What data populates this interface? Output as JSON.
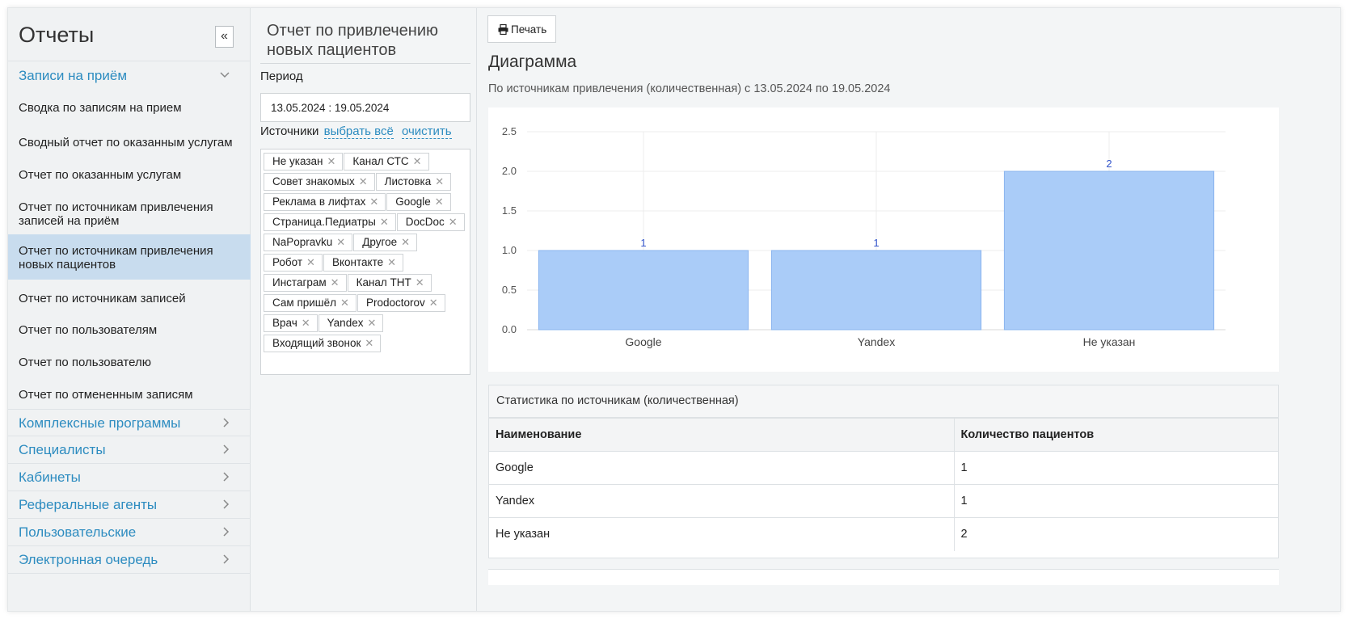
{
  "sidebar": {
    "title": "Отчеты",
    "collapse_label": "«",
    "open_group": "Записи на приём",
    "items": [
      "Сводка по записям на прием",
      "Сводный отчет по оказанным услугам",
      "Отчет по оказанным услугам",
      "Отчет по источникам привлечения записей на приём",
      "Отчет по источникам привлечения новых пациентов",
      "Отчет по источникам записей",
      "Отчет по пользователям",
      "Отчет по пользователю",
      "Отчет по отмененным записям"
    ],
    "active_index": 4,
    "groups": [
      "Комплексные программы",
      "Специалисты",
      "Кабинеты",
      "Реферальные агенты",
      "Пользовательские",
      "Электронная очередь"
    ]
  },
  "filter": {
    "title": "Отчет по привлечению новых пациентов",
    "period_label": "Период",
    "period_value": "13.05.2024  :  19.05.2024",
    "sources_label": "Источники",
    "select_all": "выбрать всё",
    "clear": "очистить",
    "tags": [
      "Не указан",
      "Канал СТС",
      "Совет знакомых",
      "Листовка",
      "Реклама в лифтах",
      "Google",
      "Страница.Педиатры",
      "DocDoc",
      "NaPopravku",
      "Другое",
      "Робот",
      "Вконтакте",
      "Инстаграм",
      "Канал ТНТ",
      "Сам пришёл",
      "Prodoctorov",
      "Врач",
      "Yandex",
      "Входящий звонок"
    ],
    "tag_remove": "✕"
  },
  "main": {
    "print_label": "Печать",
    "heading": "Диаграмма",
    "subtitle": "По источникам привлечения (количественная) с 13.05.2024 по 19.05.2024",
    "stats_title": "Статистика по источникам (количественная)",
    "table_headers": [
      "Наименование",
      "Количество пациентов"
    ],
    "table_rows": [
      [
        "Google",
        "1"
      ],
      [
        "Yandex",
        "1"
      ],
      [
        "Не указан",
        "2"
      ]
    ]
  },
  "chart_data": {
    "type": "bar",
    "categories": [
      "Google",
      "Yandex",
      "Не указан"
    ],
    "values": [
      1,
      1,
      2
    ],
    "data_labels": [
      "1",
      "1",
      "2"
    ],
    "y_ticks": [
      "0.0",
      "0.5",
      "1.0",
      "1.5",
      "2.0",
      "2.5"
    ],
    "ylim": [
      0,
      2.5
    ],
    "grid": true,
    "bar_color": "#aaccf8",
    "bar_border": "#8ab4ee",
    "label_color": "#3355cc"
  }
}
